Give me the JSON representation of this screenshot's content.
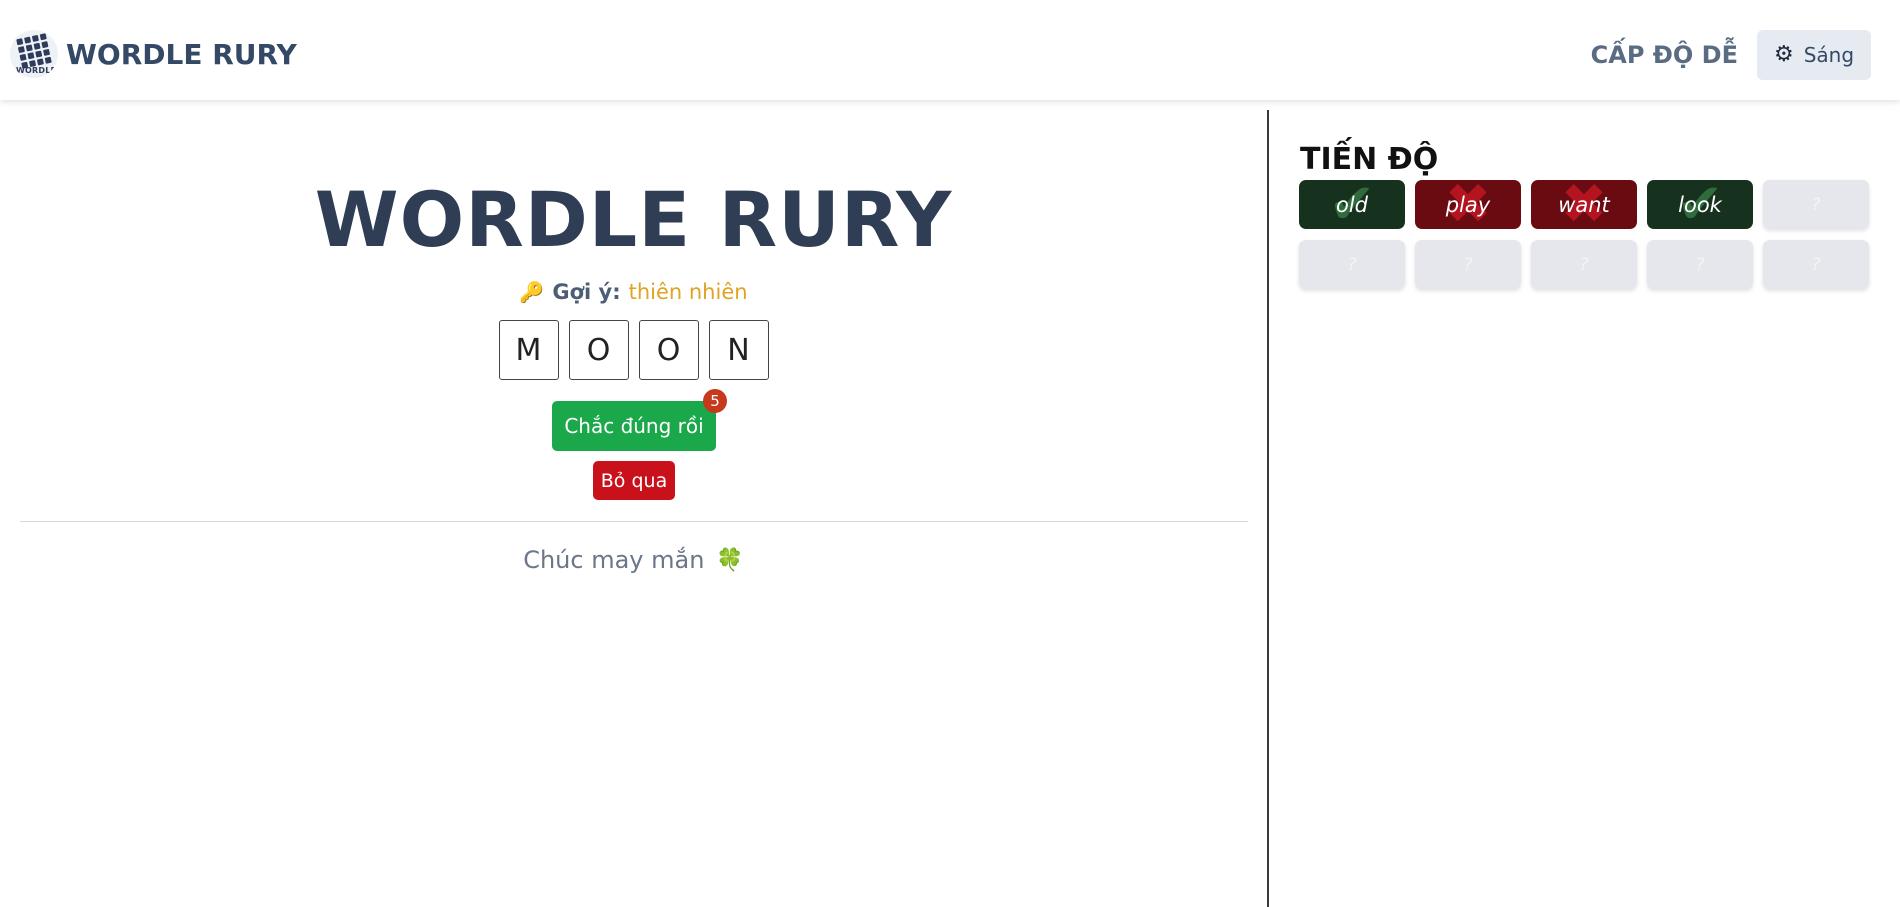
{
  "header": {
    "brand": "WORDLE RURY",
    "logo_text": "WORDLF",
    "level": "CẤP ĐỘ DỄ",
    "theme_label": "Sáng",
    "theme_icon": "gear-icon"
  },
  "main": {
    "title": "WORDLE RURY",
    "hint_icon": "🔑",
    "hint_label": "Gợi ý:",
    "hint_value": "thiên nhiên",
    "letters": [
      "M",
      "O",
      "O",
      "N"
    ],
    "submit_label": "Chắc đúng rồi",
    "submit_badge": "5",
    "skip_label": "Bỏ qua",
    "luck_text": "Chúc may mắn",
    "luck_icon": "🍀"
  },
  "progress": {
    "title": "TIẾN ĐỘ",
    "tiles": [
      {
        "word": "old",
        "status": "correct"
      },
      {
        "word": "play",
        "status": "wrong"
      },
      {
        "word": "want",
        "status": "wrong"
      },
      {
        "word": "look",
        "status": "correct"
      },
      {
        "word": "?",
        "status": "empty"
      },
      {
        "word": "?",
        "status": "empty"
      },
      {
        "word": "?",
        "status": "empty"
      },
      {
        "word": "?",
        "status": "empty"
      },
      {
        "word": "?",
        "status": "empty"
      },
      {
        "word": "?",
        "status": "empty"
      }
    ]
  },
  "colors": {
    "correct": "#16321f",
    "wrong": "#6a0b12",
    "submit": "#1aa84a",
    "skip": "#c9111b",
    "hint_value": "#e0a323"
  }
}
